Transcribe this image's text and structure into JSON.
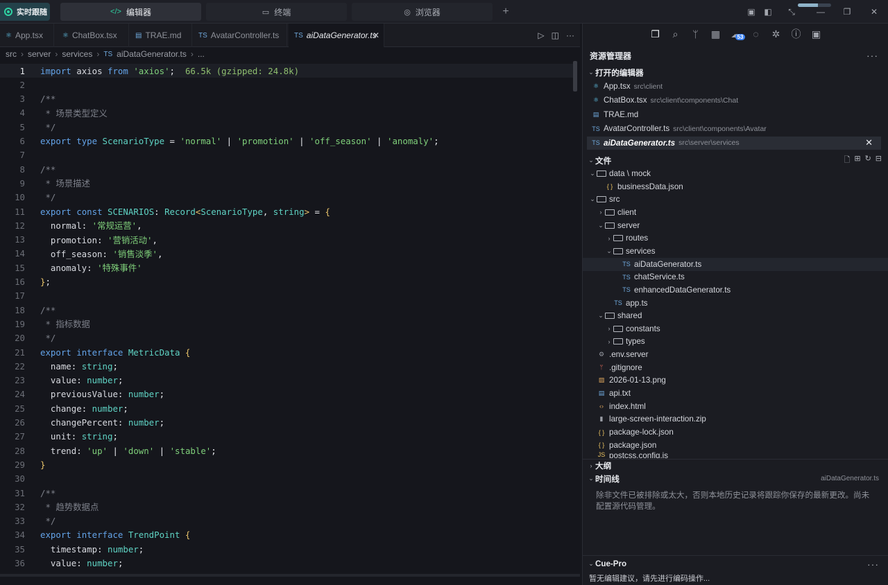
{
  "topbar": {
    "live_label": "实时跟随",
    "modes": [
      {
        "label": "编辑器",
        "icon": "code-icon",
        "active": true
      },
      {
        "label": "终端",
        "icon": "terminal-icon",
        "active": false
      },
      {
        "label": "浏览器",
        "icon": "browser-icon",
        "active": false
      }
    ],
    "add_label": "+",
    "progress": 0.6
  },
  "tabs": [
    {
      "label": "App.tsx",
      "icon": "react-icon",
      "icon_glyph": "⚛"
    },
    {
      "label": "ChatBox.tsx",
      "icon": "react-icon",
      "icon_glyph": "⚛"
    },
    {
      "label": "TRAE.md",
      "icon": "markdown-icon",
      "icon_glyph": "▤"
    },
    {
      "label": "AvatarController.ts",
      "icon": "ts-icon",
      "icon_glyph": "TS"
    },
    {
      "label": "aiDataGenerator.ts",
      "icon": "ts-icon",
      "icon_glyph": "TS",
      "active": true
    }
  ],
  "breadcrumb": [
    "src",
    "server",
    "services",
    "aiDataGenerator.ts",
    "..."
  ],
  "code_lines": [
    {
      "n": "1",
      "html": "<span class='k'>import</span> <span class='v'>axios</span> <span class='k'>from</span> <span class='s'>'axios'</span><span class='p'>;</span>  <span class='h'>66.5k (gzipped: 24.8k)</span>",
      "cur": true
    },
    {
      "n": "2",
      "html": ""
    },
    {
      "n": "3",
      "html": "<span class='c'>/**</span>"
    },
    {
      "n": "4",
      "html": "<span class='c'> * 场景类型定义</span>"
    },
    {
      "n": "5",
      "html": "<span class='c'> */</span>"
    },
    {
      "n": "6",
      "html": "<span class='k'>export</span> <span class='k'>type</span> <span class='t'>ScenarioType</span> <span class='p'>=</span> <span class='s'>'normal'</span> <span class='p'>|</span> <span class='s'>'promotion'</span> <span class='p'>|</span> <span class='s'>'off_season'</span> <span class='p'>|</span> <span class='s'>'anomaly'</span><span class='p'>;</span>"
    },
    {
      "n": "7",
      "html": ""
    },
    {
      "n": "8",
      "html": "<span class='c'>/**</span>"
    },
    {
      "n": "9",
      "html": "<span class='c'> * 场景描述</span>"
    },
    {
      "n": "10",
      "html": "<span class='c'> */</span>"
    },
    {
      "n": "11",
      "html": "<span class='k'>export</span> <span class='k'>const</span> <span class='t'>SCENARIOS</span><span class='p'>:</span> <span class='t'>Record</span><span class='b'>&lt;</span><span class='t'>ScenarioType</span><span class='p'>,</span> <span class='t'>string</span><span class='b'>&gt;</span> <span class='p'>=</span> <span class='b'>{</span>"
    },
    {
      "n": "12",
      "html": "  <span class='v'>normal</span><span class='p'>:</span> <span class='s'>'常规运营'</span><span class='p'>,</span>"
    },
    {
      "n": "13",
      "html": "  <span class='v'>promotion</span><span class='p'>:</span> <span class='s'>'营销活动'</span><span class='p'>,</span>"
    },
    {
      "n": "14",
      "html": "  <span class='v'>off_season</span><span class='p'>:</span> <span class='s'>'销售淡季'</span><span class='p'>,</span>"
    },
    {
      "n": "15",
      "html": "  <span class='v'>anomaly</span><span class='p'>:</span> <span class='s'>'特殊事件'</span>"
    },
    {
      "n": "16",
      "html": "<span class='b'>}</span><span class='p'>;</span>"
    },
    {
      "n": "17",
      "html": ""
    },
    {
      "n": "18",
      "html": "<span class='c'>/**</span>"
    },
    {
      "n": "19",
      "html": "<span class='c'> * 指标数据</span>"
    },
    {
      "n": "20",
      "html": "<span class='c'> */</span>"
    },
    {
      "n": "21",
      "html": "<span class='k'>export</span> <span class='k'>interface</span> <span class='t'>MetricData</span> <span class='b'>{</span>"
    },
    {
      "n": "22",
      "html": "  <span class='v'>name</span><span class='p'>:</span> <span class='t'>string</span><span class='p'>;</span>"
    },
    {
      "n": "23",
      "html": "  <span class='v'>value</span><span class='p'>:</span> <span class='t'>number</span><span class='p'>;</span>"
    },
    {
      "n": "24",
      "html": "  <span class='v'>previousValue</span><span class='p'>:</span> <span class='t'>number</span><span class='p'>;</span>"
    },
    {
      "n": "25",
      "html": "  <span class='v'>change</span><span class='p'>:</span> <span class='t'>number</span><span class='p'>;</span>"
    },
    {
      "n": "26",
      "html": "  <span class='v'>changePercent</span><span class='p'>:</span> <span class='t'>number</span><span class='p'>;</span>"
    },
    {
      "n": "27",
      "html": "  <span class='v'>unit</span><span class='p'>:</span> <span class='t'>string</span><span class='p'>;</span>"
    },
    {
      "n": "28",
      "html": "  <span class='v'>trend</span><span class='p'>:</span> <span class='s'>'up'</span> <span class='p'>|</span> <span class='s'>'down'</span> <span class='p'>|</span> <span class='s'>'stable'</span><span class='p'>;</span>"
    },
    {
      "n": "29",
      "html": "<span class='b'>}</span>"
    },
    {
      "n": "30",
      "html": ""
    },
    {
      "n": "31",
      "html": "<span class='c'>/**</span>"
    },
    {
      "n": "32",
      "html": "<span class='c'> * 趋势数据点</span>"
    },
    {
      "n": "33",
      "html": "<span class='c'> */</span>"
    },
    {
      "n": "34",
      "html": "<span class='k'>export</span> <span class='k'>interface</span> <span class='t'>TrendPoint</span> <span class='b'>{</span>"
    },
    {
      "n": "35",
      "html": "  <span class='v'>timestamp</span><span class='p'>:</span> <span class='t'>number</span><span class='p'>;</span>"
    },
    {
      "n": "36",
      "html": "  <span class='v'>value</span><span class='p'>:</span> <span class='t'>number</span><span class='p'>;</span>"
    }
  ],
  "sidebar": {
    "explorer_title": "资源管理器",
    "open_editors_title": "打开的编辑器",
    "open_editors": [
      {
        "name": "App.tsx",
        "path": "src\\client",
        "icon": "react-icon",
        "glyph": "⚛",
        "cls": "cyan"
      },
      {
        "name": "ChatBox.tsx",
        "path": "src\\client\\components\\Chat",
        "icon": "react-icon",
        "glyph": "⚛",
        "cls": "cyan"
      },
      {
        "name": "TRAE.md",
        "path": "",
        "icon": "markdown-icon",
        "glyph": "▤",
        "cls": "blue"
      },
      {
        "name": "AvatarController.ts",
        "path": "src\\client\\components\\Avatar",
        "icon": "ts-icon",
        "glyph": "TS",
        "cls": "blue"
      },
      {
        "name": "aiDataGenerator.ts",
        "path": "src\\server\\services",
        "icon": "ts-icon",
        "glyph": "TS",
        "cls": "blue",
        "selected": true
      }
    ],
    "files_title": "文件",
    "tree": [
      {
        "name": "data \\ mock",
        "depth": 0,
        "type": "folder",
        "open": true
      },
      {
        "name": "businessData.json",
        "depth": 1,
        "type": "file",
        "glyph": "{ }",
        "cls": "yel",
        "icon": "json-icon"
      },
      {
        "name": "src",
        "depth": 0,
        "type": "folder",
        "open": true
      },
      {
        "name": "client",
        "depth": 1,
        "type": "folder",
        "open": false
      },
      {
        "name": "server",
        "depth": 1,
        "type": "folder",
        "open": true
      },
      {
        "name": "routes",
        "depth": 2,
        "type": "folder",
        "open": false
      },
      {
        "name": "services",
        "depth": 2,
        "type": "folder",
        "open": true
      },
      {
        "name": "aiDataGenerator.ts",
        "depth": 3,
        "type": "file",
        "glyph": "TS",
        "cls": "blue",
        "icon": "ts-icon",
        "hl": true
      },
      {
        "name": "chatService.ts",
        "depth": 3,
        "type": "file",
        "glyph": "TS",
        "cls": "blue",
        "icon": "ts-icon"
      },
      {
        "name": "enhancedDataGenerator.ts",
        "depth": 3,
        "type": "file",
        "glyph": "TS",
        "cls": "blue",
        "icon": "ts-icon"
      },
      {
        "name": "app.ts",
        "depth": 2,
        "type": "file",
        "glyph": "TS",
        "cls": "blue",
        "icon": "ts-icon"
      },
      {
        "name": "shared",
        "depth": 1,
        "type": "folder",
        "open": true
      },
      {
        "name": "constants",
        "depth": 2,
        "type": "folder",
        "open": false
      },
      {
        "name": "types",
        "depth": 2,
        "type": "folder",
        "open": false
      },
      {
        "name": ".env.server",
        "depth": 0,
        "type": "file",
        "glyph": "⚙",
        "cls": "gray",
        "icon": "settings-file-icon"
      },
      {
        "name": ".gitignore",
        "depth": 0,
        "type": "file",
        "glyph": "ᛘ",
        "cls": "red",
        "icon": "git-icon"
      },
      {
        "name": "2026-01-13.png",
        "depth": 0,
        "type": "file",
        "glyph": "▨",
        "cls": "org",
        "icon": "image-file-icon"
      },
      {
        "name": "api.txt",
        "depth": 0,
        "type": "file",
        "glyph": "▤",
        "cls": "blue",
        "icon": "text-file-icon"
      },
      {
        "name": "index.html",
        "depth": 0,
        "type": "file",
        "glyph": "‹›",
        "cls": "org",
        "icon": "html-icon"
      },
      {
        "name": "large-screen-interaction.zip",
        "depth": 0,
        "type": "file",
        "glyph": "▮",
        "cls": "gray",
        "icon": "zip-icon"
      },
      {
        "name": "package-lock.json",
        "depth": 0,
        "type": "file",
        "glyph": "{ }",
        "cls": "yel",
        "icon": "json-icon"
      },
      {
        "name": "package.json",
        "depth": 0,
        "type": "file",
        "glyph": "{ }",
        "cls": "yel",
        "icon": "json-icon"
      },
      {
        "name": "postcss.config.js",
        "depth": 0,
        "type": "file",
        "glyph": "JS",
        "cls": "yel",
        "icon": "js-icon"
      }
    ],
    "outline_title": "大纲",
    "timeline_title": "时间线",
    "timeline_file": "aiDataGenerator.ts",
    "timeline_note": "除非文件已被排除或太大，否则本地历史记录将跟踪你保存的最新更改。尚未配置源代码管理。",
    "cue_title": "Cue-Pro",
    "cue_note": "暂无编辑建议，请先进行编码操作...",
    "activity_badge": "53",
    "more": "···"
  }
}
